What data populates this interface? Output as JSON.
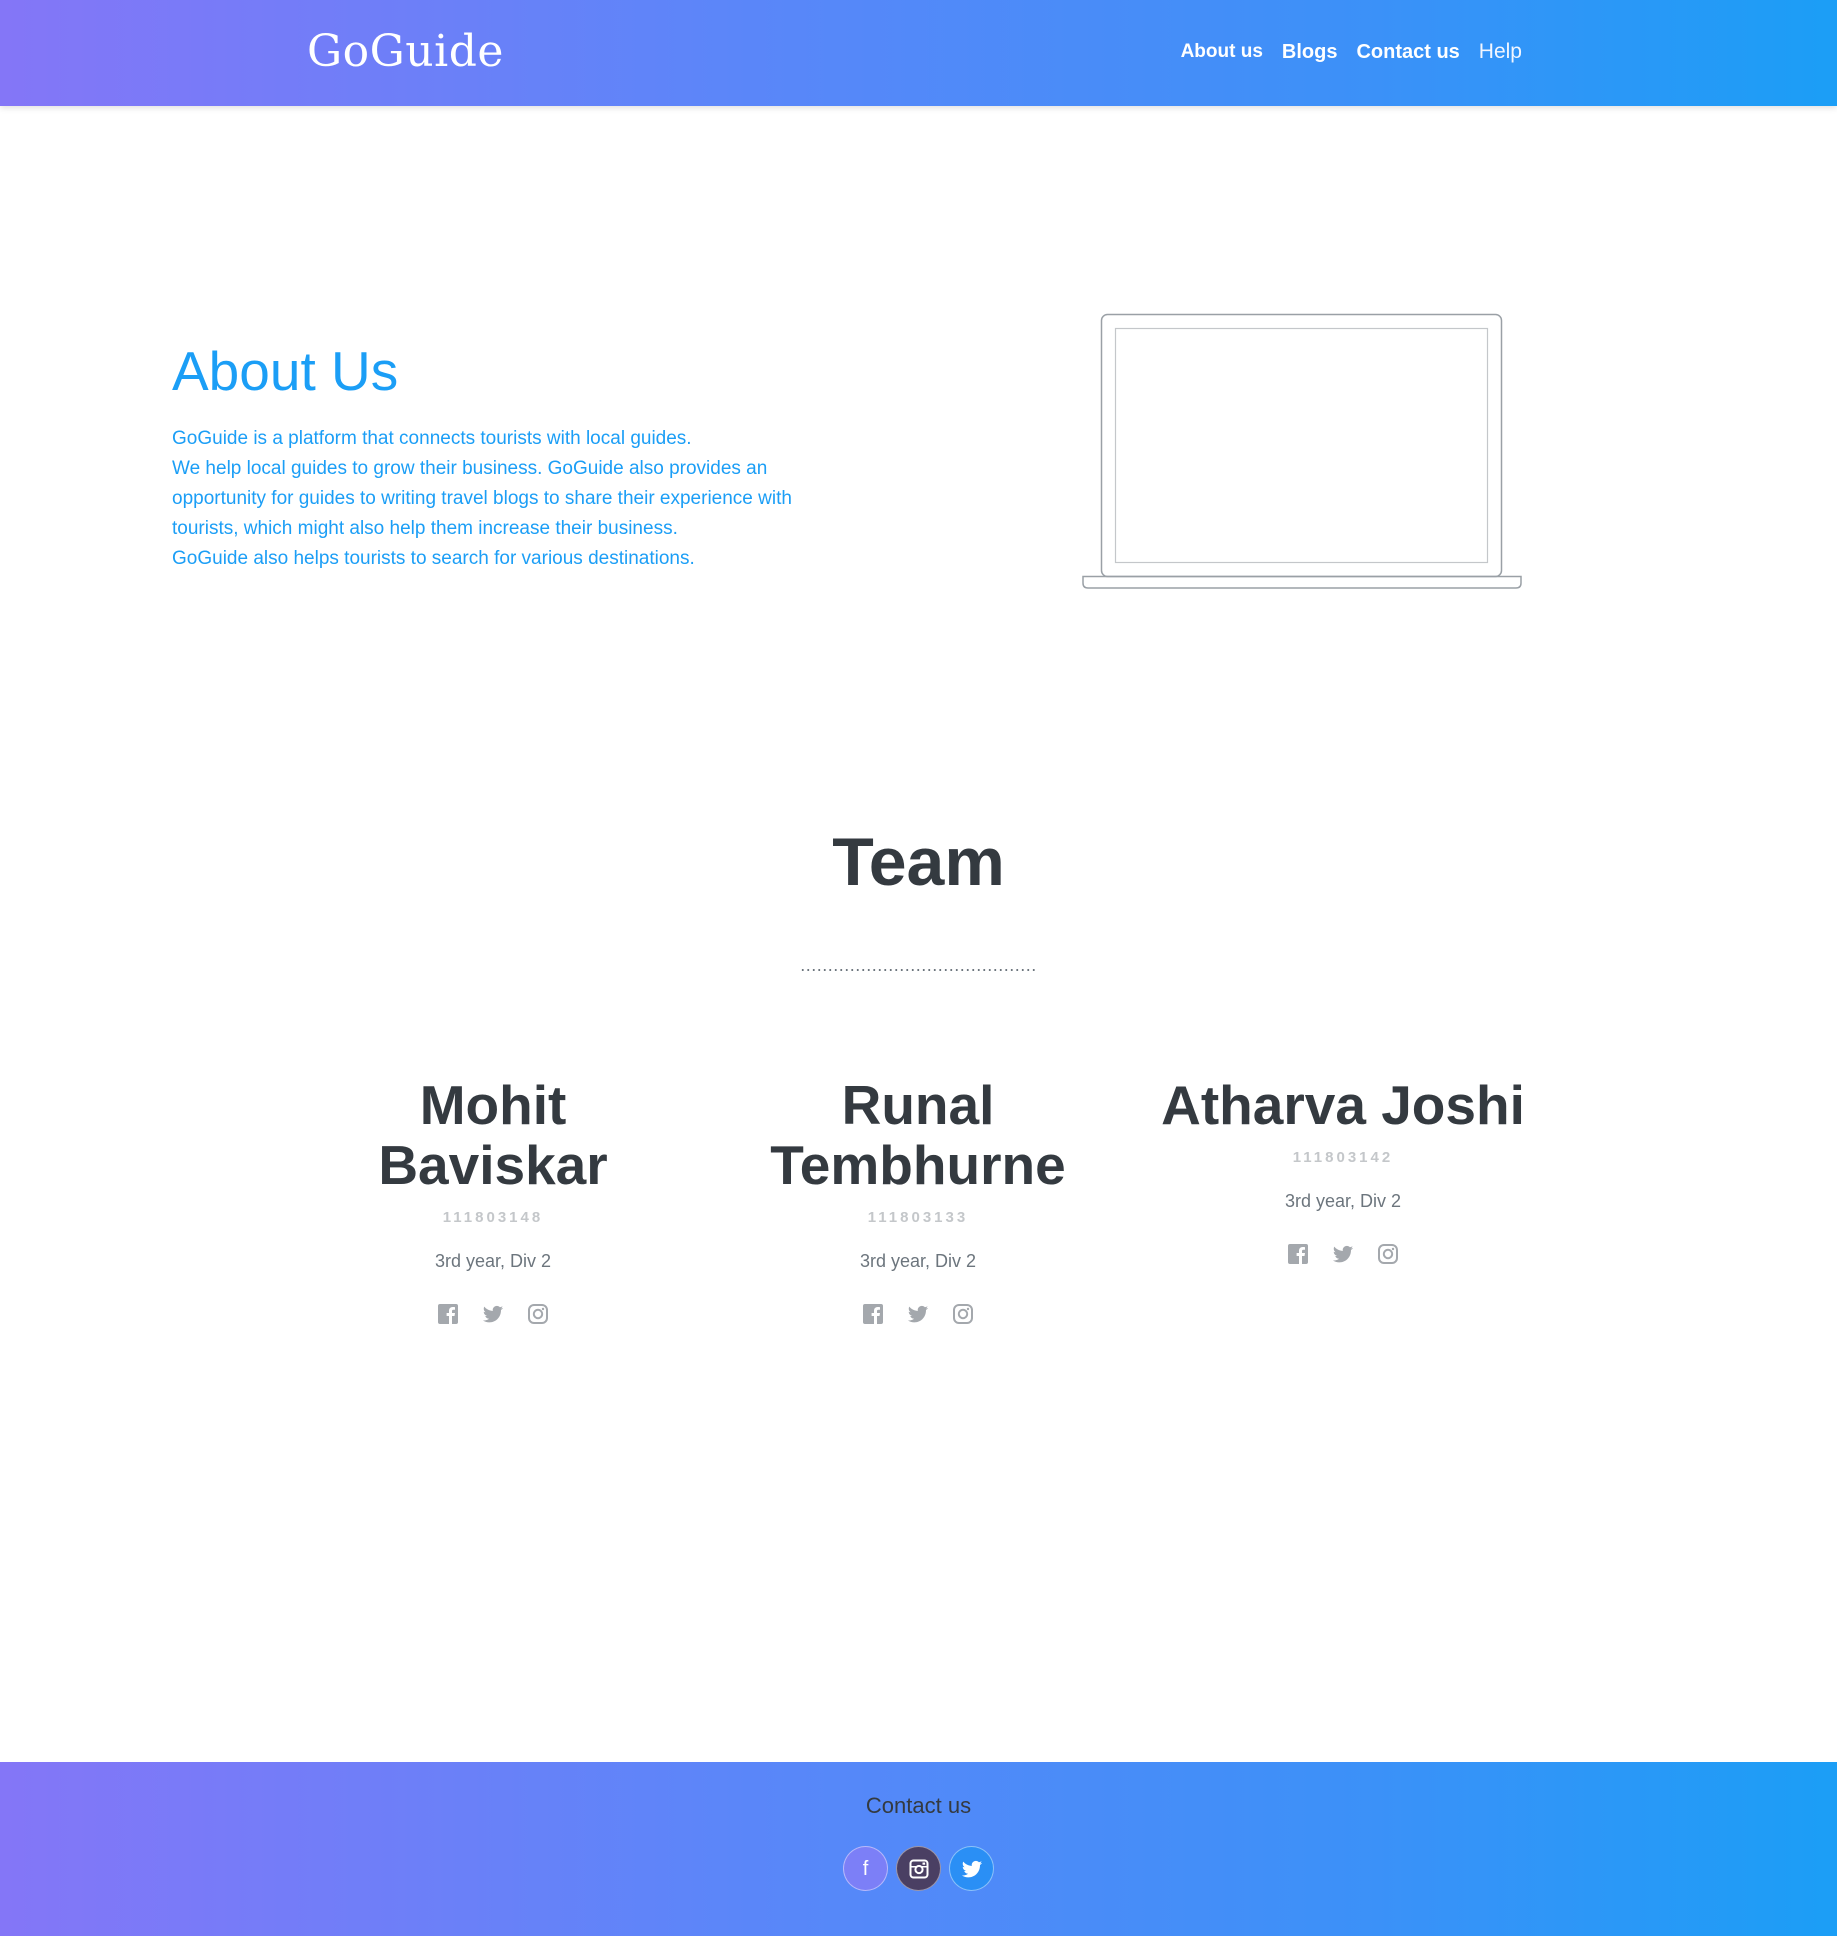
{
  "navbar": {
    "brand": "GoGuide",
    "links": [
      {
        "label": "About us"
      },
      {
        "label": "Blogs"
      },
      {
        "label": "Contact us"
      },
      {
        "label": "Help"
      }
    ]
  },
  "about": {
    "title": "About Us",
    "paragraphs": [
      "GoGuide is a platform that connects tourists with local guides.",
      "We help local guides to grow their business. GoGuide also provides an opportunity for guides to writing travel blogs to share their experience with tourists, which might also help them increase their business.",
      "GoGuide also helps tourists to search for various destinations."
    ],
    "illustration": "laptop-outline"
  },
  "team": {
    "title": "Team",
    "divider": "...........................................",
    "members": [
      {
        "name": "Mohit Baviskar",
        "id": "111803148",
        "year": "3rd year, Div 2",
        "socials": [
          "facebook-icon",
          "twitter-icon",
          "instagram-icon"
        ]
      },
      {
        "name": "Runal Tembhurne",
        "id": "111803133",
        "year": "3rd year, Div 2",
        "socials": [
          "facebook-icon",
          "twitter-icon",
          "instagram-icon"
        ]
      },
      {
        "name": "Atharva Joshi",
        "id": "111803142",
        "year": "3rd year, Div 2",
        "socials": [
          "facebook-icon",
          "twitter-icon",
          "instagram-icon"
        ]
      }
    ]
  },
  "footer": {
    "title": "Contact us",
    "socials": [
      "facebook-icon",
      "instagram-icon",
      "twitter-icon"
    ],
    "facebook_glyph": "f"
  },
  "colors": {
    "accent": "#1b9ef6",
    "gradient_start": "#8476f7",
    "gradient_end": "#1b9ef6",
    "heading": "#343a40",
    "muted": "#6c757d"
  }
}
